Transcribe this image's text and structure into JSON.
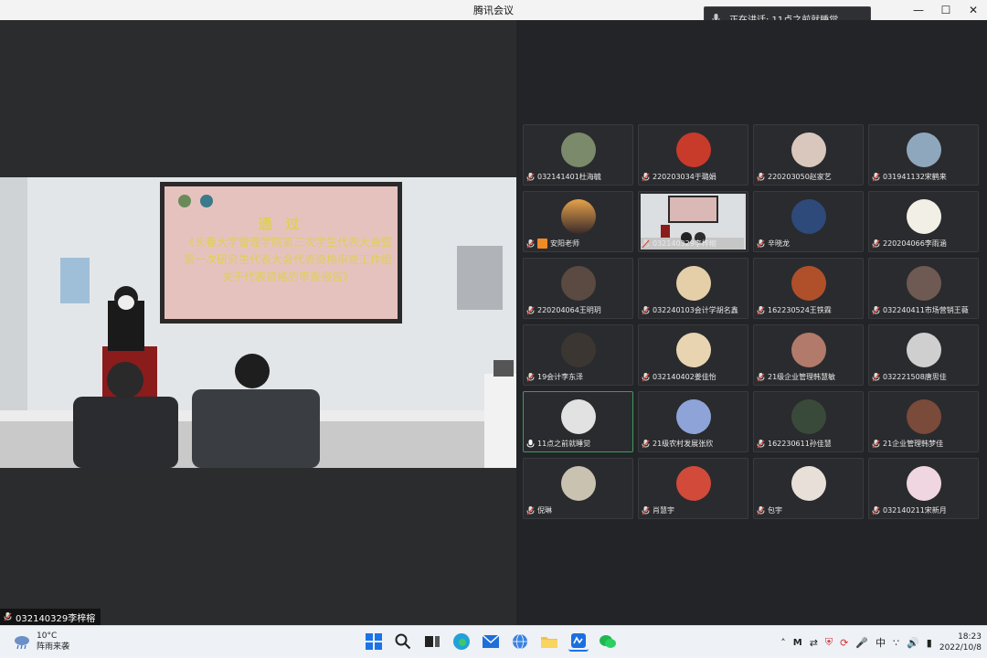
{
  "window": {
    "title": "腾讯会议"
  },
  "speaking": {
    "text": "正在讲话: 11点之前就睡觉"
  },
  "stage": {
    "name": "032140329李梓榕"
  },
  "slide": {
    "heading": "通　过",
    "body": "《长春大学管理学院第三次学生代表大会暨第一次研究生代表大会代表资格审查工作组关于代表资格的审查报告》"
  },
  "participants": [
    {
      "name": "032141401杜海毓",
      "avatar": "#7a8a6a"
    },
    {
      "name": "220203034于璐娟",
      "avatar": "#c83a2a"
    },
    {
      "name": "220203050赵家艺",
      "avatar": "#d9c7bd"
    },
    {
      "name": "031941132宋鹤来",
      "avatar": "#8fa7bd"
    },
    {
      "name": "安阳老师",
      "avatar": "#cc8a3a"
    },
    {
      "name": "032140329李梓榕",
      "avatar": ""
    },
    {
      "name": "辛晓龙",
      "avatar": "#2e4a7a"
    },
    {
      "name": "220204066李雨涵",
      "avatar": "#f2efe6"
    },
    {
      "name": "220204064王明玥",
      "avatar": "#5a4a42"
    },
    {
      "name": "032240103会计学胡名鑫",
      "avatar": "#e4cfa8"
    },
    {
      "name": "162230524王铁霖",
      "avatar": "#b0502a"
    },
    {
      "name": "032240411市场营销王薇",
      "avatar": "#6e5a52"
    },
    {
      "name": "19会计李东泽",
      "avatar": "#3c3632"
    },
    {
      "name": "032140402姜佳怡",
      "avatar": "#e8d4b0"
    },
    {
      "name": "21级企业管理韩慧敏",
      "avatar": "#b27a6a"
    },
    {
      "name": "032221508唐思佳",
      "avatar": "#cfcfcf"
    },
    {
      "name": "11点之前就睡觉",
      "avatar": "#e2e2e2"
    },
    {
      "name": "21级农村发展张欣",
      "avatar": "#8ea4d8"
    },
    {
      "name": "162230611孙佳慧",
      "avatar": "#3a4a3a"
    },
    {
      "name": "21企业管理韩梦佳",
      "avatar": "#7a4a3a"
    },
    {
      "name": "倪琳",
      "avatar": "#c9c2b0"
    },
    {
      "name": "肖慧宇",
      "avatar": "#d24a3a"
    },
    {
      "name": "包宇",
      "avatar": "#e8e0d8"
    },
    {
      "name": "032140211宋新月",
      "avatar": "#f0d6e0"
    }
  ],
  "taskbar": {
    "weather_temp": "10°C",
    "weather_desc": "阵雨来袭",
    "ime": "中",
    "time": "18:23",
    "date": "2022/10/8"
  }
}
